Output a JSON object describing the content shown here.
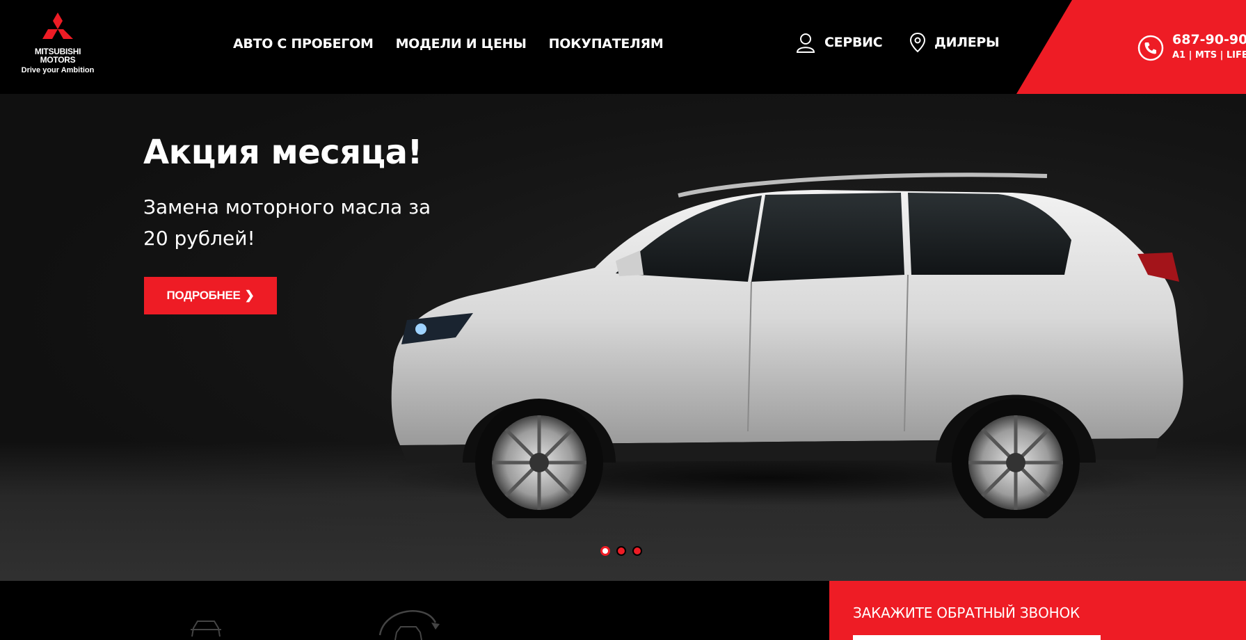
{
  "header": {
    "logo": {
      "brand_line1": "MITSUBISHI",
      "brand_line2": "MOTORS",
      "tagline": "Drive your Ambition",
      "icon": "three-diamonds-icon"
    },
    "nav": [
      {
        "label": "АВТО С ПРОБЕГОМ"
      },
      {
        "label": "МОДЕЛИ И ЦЕНЫ"
      },
      {
        "label": "ПОКУПАТЕЛЯМ"
      }
    ],
    "service": {
      "label": "СЕРВИС",
      "icon": "person-icon"
    },
    "dealers": {
      "label": "ДИЛЕРЫ",
      "icon": "location-pin-icon"
    },
    "phone": {
      "number": "687-90-90",
      "operators": "A1 | MTS | LIFE",
      "icon": "phone-icon"
    }
  },
  "hero": {
    "title": "Акция месяца!",
    "subtitle": "Замена моторного масла за 20 рублей!",
    "button_label": "ПОДРОБНЕЕ",
    "button_icon": "chevron-right-icon",
    "slides_count": 3,
    "active_slide": 1
  },
  "bottom": {
    "icons": [
      "car-icon",
      "car-rotate-icon"
    ],
    "callback": {
      "title": "ЗАКАЖИТЕ ОБРАТНЫЙ ЗВОНОК"
    }
  },
  "colors": {
    "accent": "#ee1c25",
    "header_bg": "#000000",
    "hero_bg": "#141414"
  }
}
